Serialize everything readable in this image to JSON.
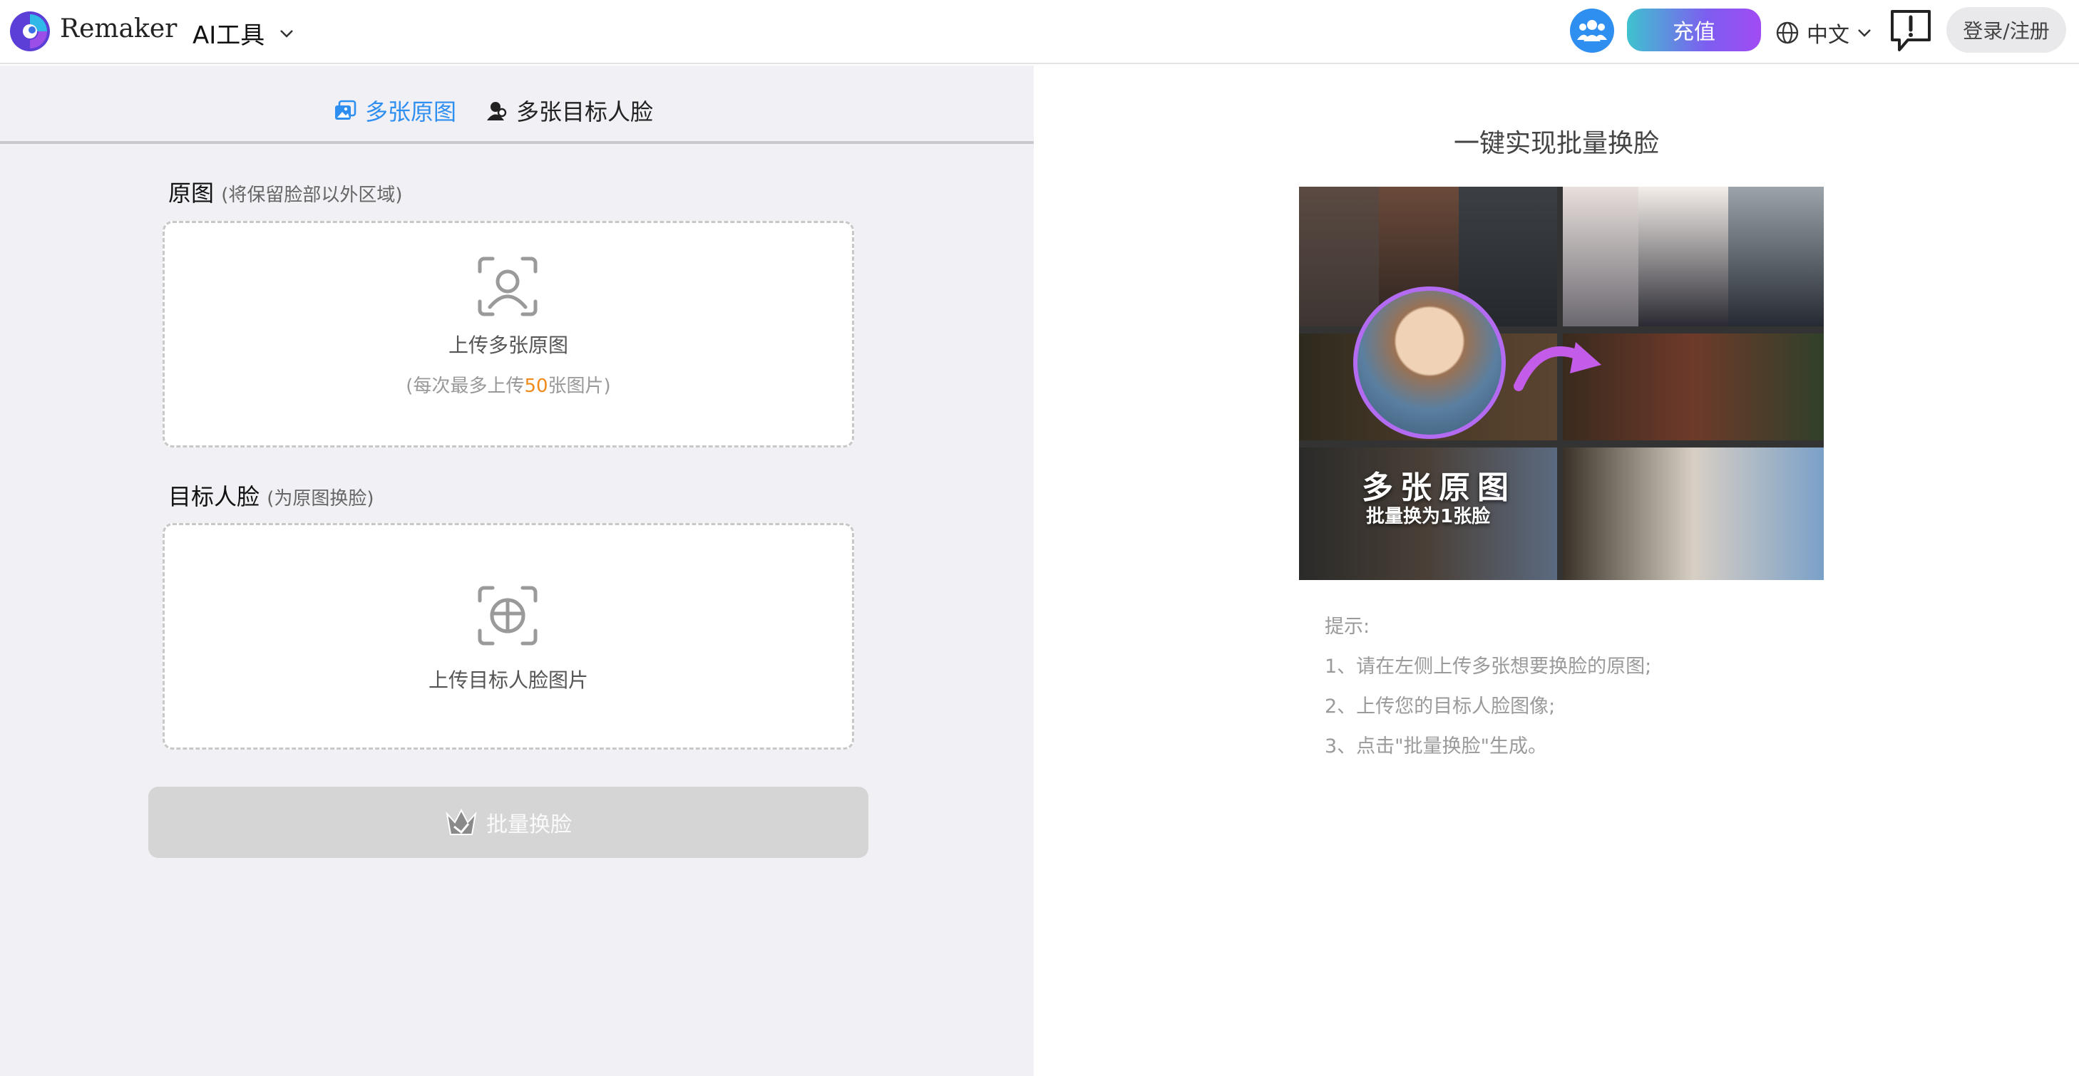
{
  "header": {
    "brand": "Remaker",
    "ai_tools_label": "AI工具",
    "recharge_label": "充值",
    "language_label": "中文",
    "login_label": "登录/注册"
  },
  "tabs": [
    {
      "label": "多张原图",
      "active": true
    },
    {
      "label": "多张目标人脸",
      "active": false
    }
  ],
  "source_section": {
    "title": "原图",
    "note": "(将保留脸部以外区域)",
    "upload_label": "上传多张原图",
    "hint_prefix": "(每次最多上传",
    "hint_count": "50",
    "hint_suffix": "张图片)"
  },
  "target_section": {
    "title": "目标人脸",
    "note": "(为原图换脸)",
    "upload_label": "上传目标人脸图片"
  },
  "batch_button_label": "批量换脸",
  "right": {
    "title": "一键实现批量换脸",
    "demo_big_text": "多张原图",
    "demo_small_text": "批量换为1张脸",
    "tips": [
      "提示:",
      "1、请在左侧上传多张想要换脸的原图;",
      "2、上传您的目标人脸图像;",
      "3、点击\"批量换脸\"生成。"
    ]
  },
  "colors": {
    "accent": "#2f8ff0",
    "highlight": "#f08a1a",
    "disabled_button": "#d5d5d6"
  }
}
